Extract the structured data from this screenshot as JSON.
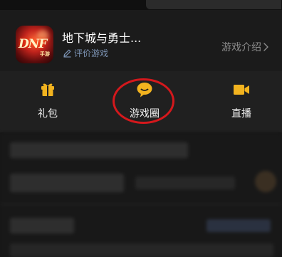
{
  "game": {
    "title": "地下城与勇士...",
    "rate_label": "评价游戏",
    "intro_label": "游戏介绍",
    "icon_text": "DNF",
    "icon_subtext": "手游"
  },
  "features": [
    {
      "label": "礼包",
      "icon": "gift-icon"
    },
    {
      "label": "游戏圈",
      "icon": "chat-bubble-icon"
    },
    {
      "label": "直播",
      "icon": "video-camera-icon"
    }
  ],
  "colors": {
    "accent_yellow": "#f2b31f",
    "highlight_ring": "#d4181c",
    "link_blue": "#7c93b3"
  }
}
